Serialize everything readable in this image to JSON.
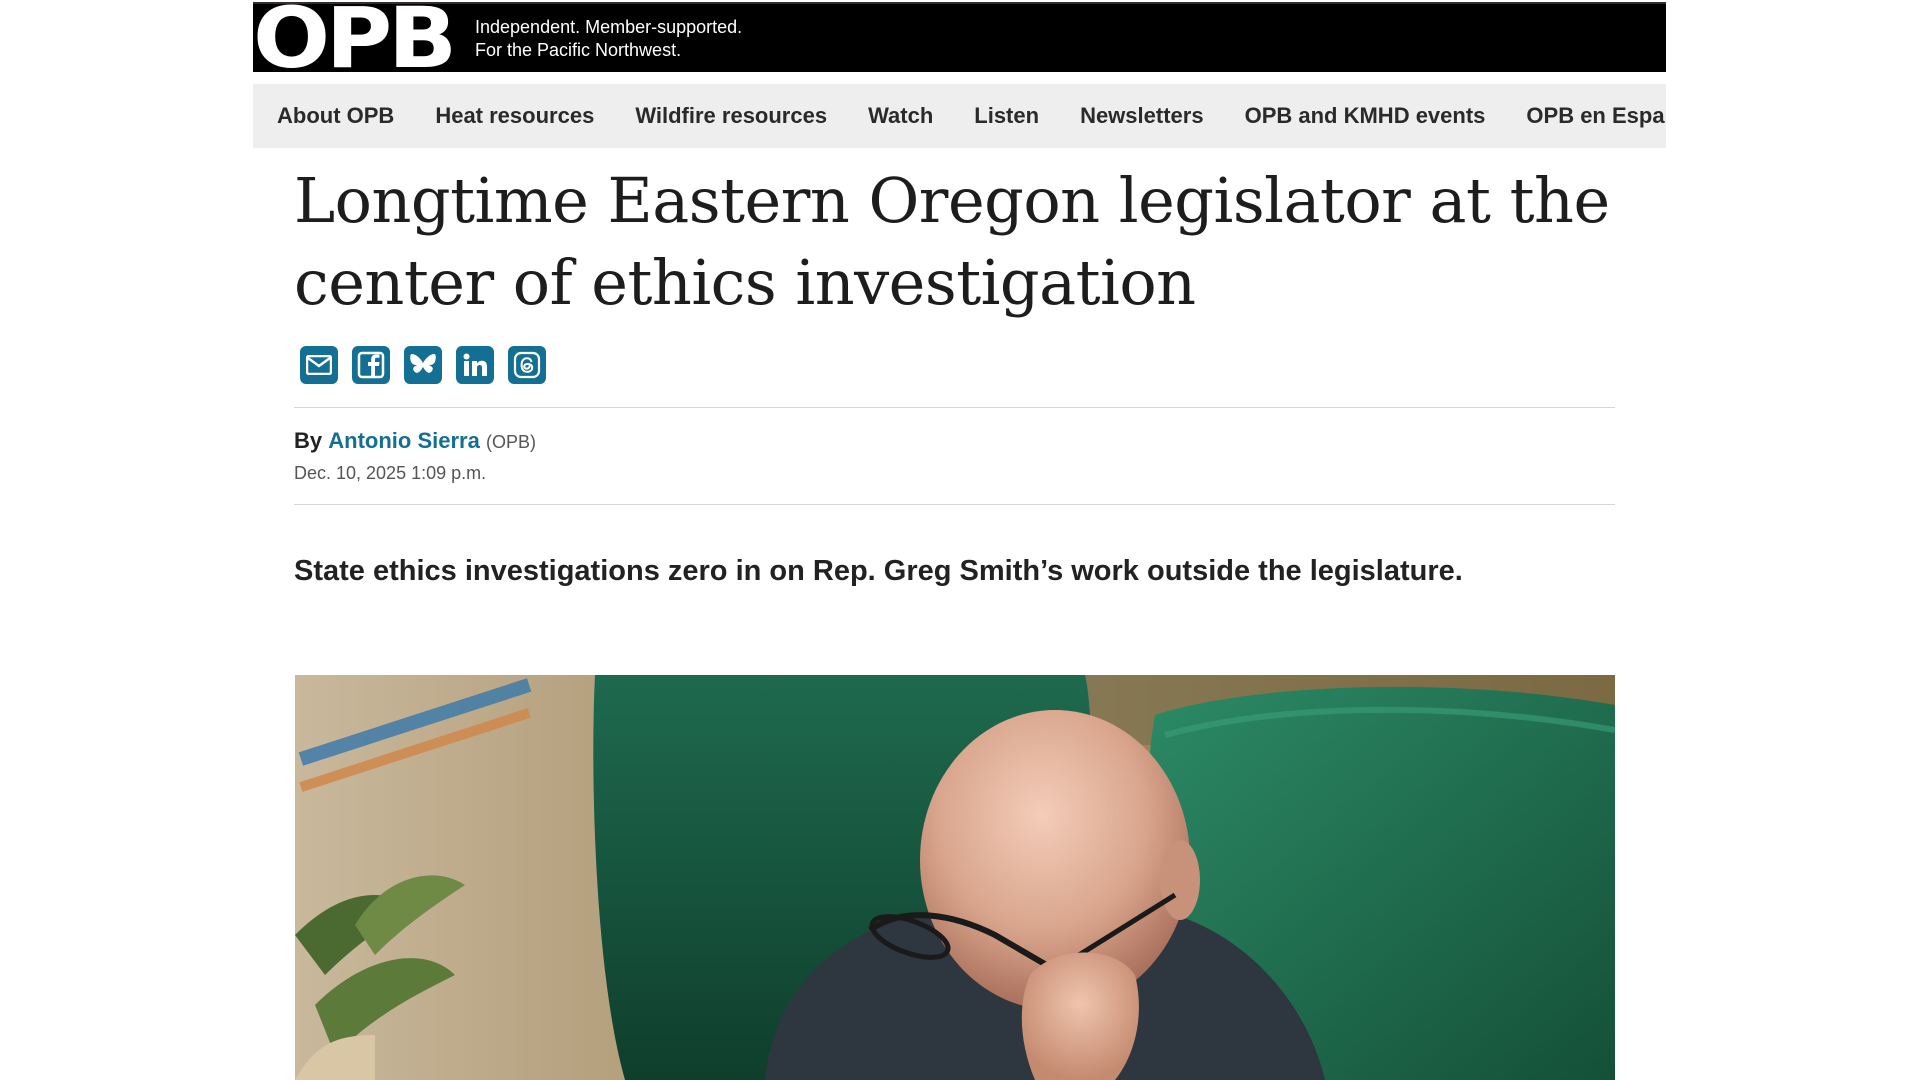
{
  "header": {
    "logo": "OPB",
    "tagline_line1": "Independent. Member-supported.",
    "tagline_line2": "For the Pacific Northwest."
  },
  "nav": {
    "items": [
      {
        "label": "About OPB"
      },
      {
        "label": "Heat resources"
      },
      {
        "label": "Wildfire resources"
      },
      {
        "label": "Watch"
      },
      {
        "label": "Listen"
      },
      {
        "label": "Newsletters"
      },
      {
        "label": "OPB and KMHD events"
      },
      {
        "label": "OPB en Español"
      }
    ]
  },
  "article": {
    "headline": "Longtime Eastern Oregon legislator at the center of ethics investigation",
    "share_icons": [
      "email-icon",
      "facebook-icon",
      "bluesky-icon",
      "linkedin-icon",
      "threads-icon"
    ],
    "byline_prefix": "By",
    "author": "Antonio Sierra",
    "organization": "(OPB)",
    "date": "Dec. 10, 2025 1:09 p.m.",
    "dek": "State ethics investigations zero in on Rep. Greg Smith’s work outside the legislature."
  },
  "colors": {
    "accent": "#146f95",
    "masthead": "#000000",
    "nav_background": "#eeeeee"
  }
}
